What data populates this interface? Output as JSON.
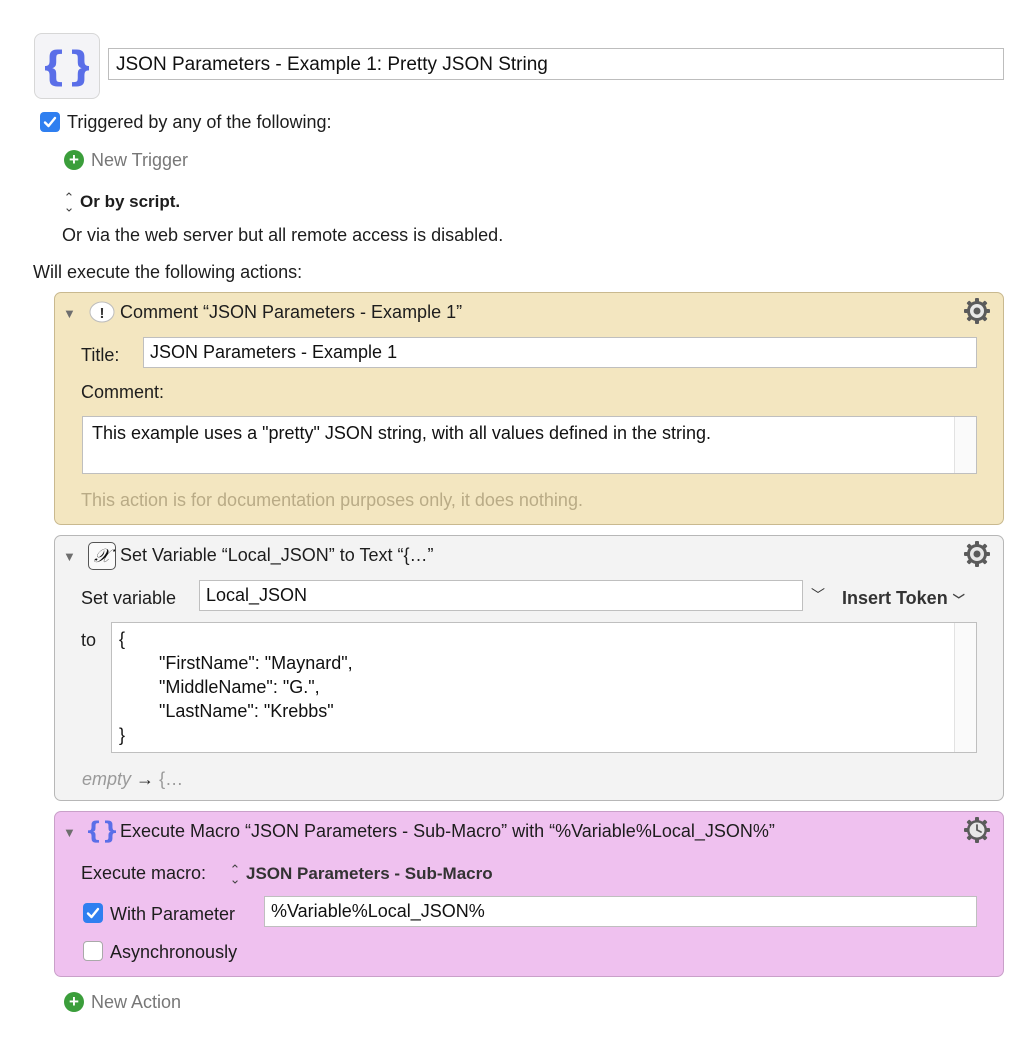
{
  "macro": {
    "icon": "curly-braces-icon",
    "name": "JSON Parameters - Example 1: Pretty JSON String"
  },
  "triggers": {
    "checked": true,
    "label": "Triggered by any of the following:",
    "new_trigger_label": "New Trigger",
    "or_by_script_label": "Or by script.",
    "web_server_text": "Or via the web server but all remote access is disabled."
  },
  "actions_heading": "Will execute the following actions:",
  "actions": {
    "comment": {
      "header": "Comment “JSON Parameters - Example 1”",
      "title_label": "Title:",
      "title_value": "JSON Parameters - Example 1",
      "comment_label": "Comment:",
      "comment_value": "This example uses a \"pretty\" JSON string, with all values defined in the string.",
      "note": "This action is for documentation purposes only, it does nothing.",
      "color": "#f3e6c0"
    },
    "set_variable": {
      "header": "Set Variable “Local_JSON” to Text “{…”",
      "set_variable_label": "Set variable",
      "variable_name": "Local_JSON",
      "insert_token_label": "Insert Token",
      "to_label": "to",
      "text_lines": [
        "{",
        "        \"FirstName\": \"Maynard\",",
        "        \"MiddleName\": \"G.\",",
        "        \"LastName\": \"Krebbs\"",
        "}"
      ],
      "preview_empty": "empty",
      "preview_arrow": "→",
      "preview_value": "{…"
    },
    "execute_macro": {
      "header": "Execute Macro “JSON Parameters - Sub-Macro” with “%Variable%Local_JSON%”",
      "execute_label": "Execute macro:",
      "macro_selected": "JSON Parameters - Sub-Macro",
      "with_parameter_label": "With Parameter",
      "with_parameter_checked": true,
      "parameter_value": "%Variable%Local_JSON%",
      "async_label": "Asynchronously",
      "async_checked": false,
      "color": "#efc1ef"
    }
  },
  "new_action_label": "New Action",
  "colors": {
    "accent": "#2f7ff0",
    "add_green": "#3b9e3b",
    "icon_purple": "#5a6ee8"
  }
}
